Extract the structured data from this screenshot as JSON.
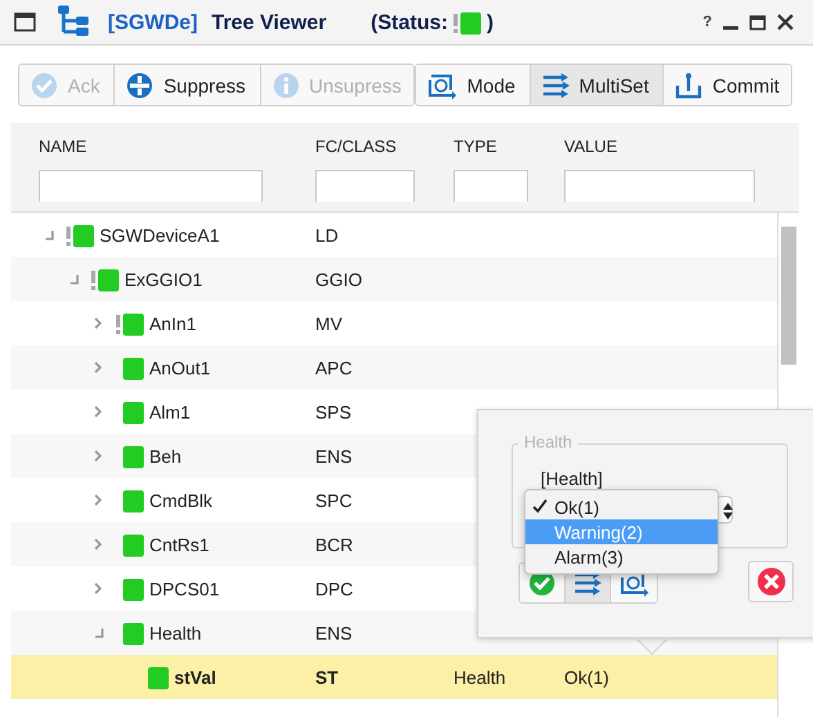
{
  "window": {
    "title_prefix": "[SGWDe]",
    "title": "Tree Viewer",
    "status_open": "(Status:",
    "status_close": ")",
    "status_flag": true,
    "help": "?"
  },
  "toolbar": {
    "left": [
      {
        "label": "Ack",
        "kind": "check",
        "disabled": true
      },
      {
        "label": "Suppress",
        "kind": "suppress",
        "disabled": false
      },
      {
        "label": "Unsupress",
        "kind": "info",
        "disabled": true
      }
    ],
    "right": [
      {
        "label": "Mode",
        "kind": "mode",
        "selected": false
      },
      {
        "label": "MultiSet",
        "kind": "multiset",
        "selected": true
      },
      {
        "label": "Commit",
        "kind": "commit",
        "selected": false
      }
    ]
  },
  "table": {
    "columns": [
      {
        "label": "NAME"
      },
      {
        "label": "FC/CLASS"
      },
      {
        "label": "TYPE"
      },
      {
        "label": "VALUE"
      }
    ],
    "rows": [
      {
        "name": "SGWDeviceA1",
        "fc": "LD",
        "flag": true,
        "expanded": true,
        "selected": false,
        "children": [
          {
            "name": "ExGGIO1",
            "fc": "GGIO",
            "flag": true,
            "expanded": true,
            "selected": false,
            "children": [
              {
                "name": "AnIn1",
                "fc": "MV",
                "flag": true,
                "expanded": false,
                "selected": false
              },
              {
                "name": "AnOut1",
                "fc": "APC",
                "flag": false,
                "expanded": false,
                "selected": false
              },
              {
                "name": "Alm1",
                "fc": "SPS",
                "flag": false,
                "expanded": false,
                "selected": false
              },
              {
                "name": "Beh",
                "fc": "ENS",
                "flag": false,
                "expanded": false,
                "selected": false
              },
              {
                "name": "CmdBlk",
                "fc": "SPC",
                "flag": false,
                "expanded": false,
                "selected": false
              },
              {
                "name": "CntRs1",
                "fc": "BCR",
                "flag": false,
                "expanded": false,
                "selected": false
              },
              {
                "name": "DPCS01",
                "fc": "DPC",
                "flag": false,
                "expanded": false,
                "selected": false
              },
              {
                "name": "Health",
                "fc": "ENS",
                "flag": false,
                "expanded": true,
                "selected": false,
                "children": [
                  {
                    "name": "stVal",
                    "fc": "ST",
                    "type": "Health",
                    "value": "Ok(1)",
                    "flag": false,
                    "selected": true
                  }
                ]
              }
            ]
          }
        ]
      }
    ]
  },
  "popup": {
    "group_label": "Health",
    "field_label": "[Health]",
    "options": [
      {
        "label": "Ok(1)",
        "checked": true,
        "selected": false
      },
      {
        "label": "Warning(2)",
        "checked": false,
        "selected": true
      },
      {
        "label": "Alarm(3)",
        "checked": false,
        "selected": false
      }
    ],
    "buttons": [
      {
        "kind": "accept",
        "selected": false
      },
      {
        "kind": "multiset",
        "selected": true
      },
      {
        "kind": "mode",
        "selected": false
      }
    ],
    "cancel": {
      "kind": "cancel"
    }
  }
}
